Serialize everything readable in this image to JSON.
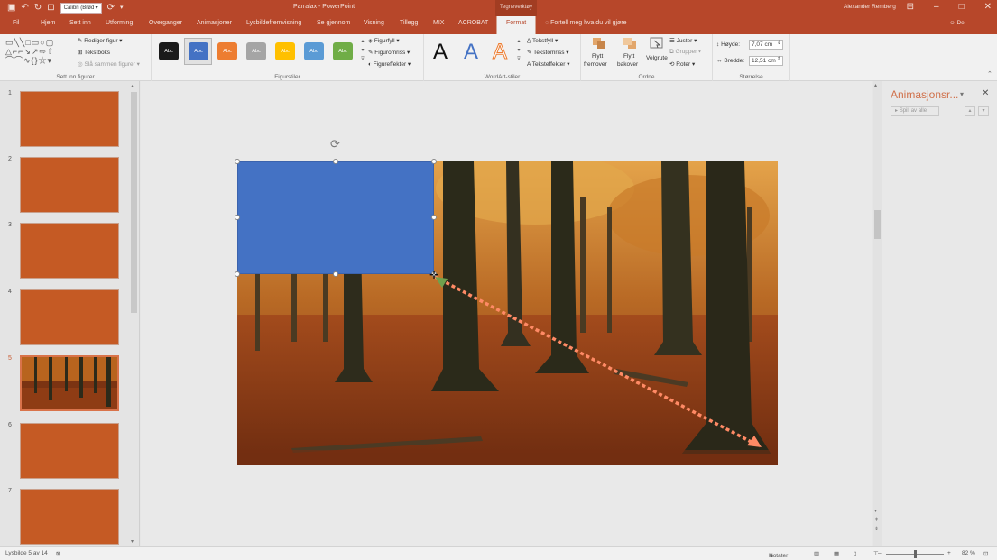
{
  "window": {
    "document_title": "Parralax - PowerPoint",
    "context_group": "Tegneverktøy",
    "user": "Alexander Remberg",
    "quick_access": {
      "font_name": "Calibri (Brød"
    }
  },
  "tabs": [
    {
      "label": "Fil"
    },
    {
      "label": "Hjem"
    },
    {
      "label": "Sett inn"
    },
    {
      "label": "Utforming"
    },
    {
      "label": "Overganger"
    },
    {
      "label": "Animasjoner"
    },
    {
      "label": "Lysbildefremvisning"
    },
    {
      "label": "Se gjennom"
    },
    {
      "label": "Visning"
    },
    {
      "label": "Tillegg"
    },
    {
      "label": "MIX"
    },
    {
      "label": "ACROBAT"
    },
    {
      "label": "Format"
    }
  ],
  "tell_me": "Fortell meg hva du vil gjøre",
  "share": "Del",
  "ribbon": {
    "insert_shapes": {
      "group_label": "Sett inn figurer",
      "edit_shape": "Rediger figur",
      "textbox": "Tekstboks",
      "merge_shapes": "Slå sammen figurer"
    },
    "shape_styles": {
      "group_label": "Figurstiler",
      "preset_label": "Abc",
      "fill": "Figurfyll",
      "outline": "Figuromriss",
      "effects": "Figureffekter",
      "swatches": [
        "#1a1a1a",
        "#4472c4",
        "#ed7d31",
        "#a5a5a5",
        "#ffc000",
        "#5b9bd5",
        "#70ad47"
      ]
    },
    "wordart": {
      "group_label": "WordArt-stiler",
      "sample": "A",
      "text_fill": "Tekstfyll",
      "text_outline": "Tekstomriss",
      "text_effects": "Teksteffekter"
    },
    "arrange": {
      "group_label": "Ordne",
      "bring_forward_1": "Flytt",
      "bring_forward_2": "fremover",
      "send_backward_1": "Flytt",
      "send_backward_2": "bakover",
      "selection": "Velgrute",
      "align": "Juster",
      "group": "Grupper",
      "rotate": "Roter"
    },
    "size": {
      "group_label": "Størrelse",
      "height_label": "Høyde:",
      "height_value": "7,07 cm",
      "width_label": "Bredde:",
      "width_value": "12,51 cm"
    }
  },
  "slides": [
    {
      "number": "1",
      "selected": false
    },
    {
      "number": "2",
      "selected": false
    },
    {
      "number": "3",
      "selected": false
    },
    {
      "number": "4",
      "selected": false
    },
    {
      "number": "5",
      "selected": true
    },
    {
      "number": "6",
      "selected": false
    },
    {
      "number": "7",
      "selected": false
    }
  ],
  "animation_pane": {
    "title": "Animasjonsr...",
    "play_label": "Spill av alle"
  },
  "status": {
    "slide_info": "Lysbilde 5 av 14",
    "notes": "Notater",
    "zoom": "82 %"
  },
  "colors": {
    "accent": "#b7472a",
    "shape_fill": "#4472c4",
    "slide_thumb": "#c55a24",
    "motion_path": "#ff8a65"
  }
}
